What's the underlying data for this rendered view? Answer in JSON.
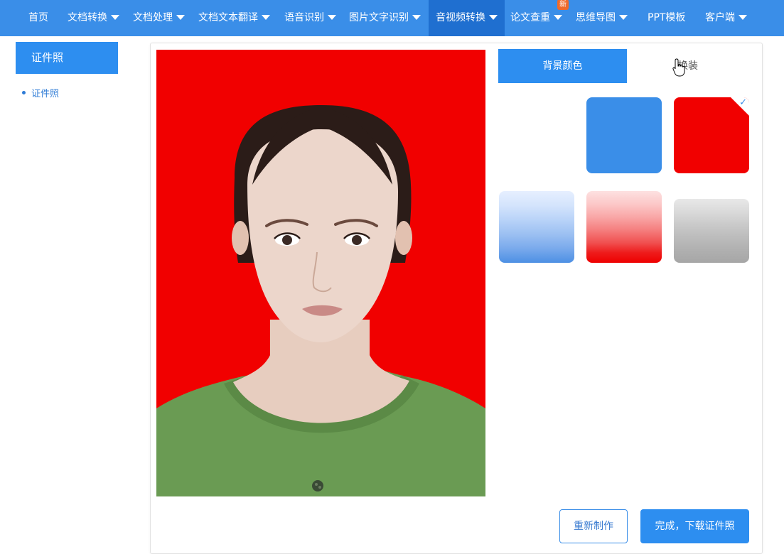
{
  "nav": {
    "items": [
      {
        "label": "首页",
        "dropdown": false,
        "active": false
      },
      {
        "label": "文档转换",
        "dropdown": true,
        "active": false
      },
      {
        "label": "文档处理",
        "dropdown": true,
        "active": false
      },
      {
        "label": "文档文本翻译",
        "dropdown": true,
        "active": false
      },
      {
        "label": "语音识别",
        "dropdown": true,
        "active": false
      },
      {
        "label": "图片文字识别",
        "dropdown": true,
        "active": false
      },
      {
        "label": "音视频转换",
        "dropdown": true,
        "active": true
      },
      {
        "label": "论文查重",
        "dropdown": true,
        "active": false,
        "badge": "新"
      },
      {
        "label": "思维导图",
        "dropdown": true,
        "active": false
      },
      {
        "label": "PPT模板",
        "dropdown": false,
        "active": false
      },
      {
        "label": "客户端",
        "dropdown": true,
        "active": false
      }
    ]
  },
  "sidebar": {
    "title": "证件照",
    "link": "证件照"
  },
  "tabs": {
    "background": "背景颜色",
    "outfit": "换装"
  },
  "swatches": [
    {
      "name": "blue",
      "color": "#3a8ee8",
      "selected": false
    },
    {
      "name": "red",
      "color": "#f10000",
      "selected": true
    },
    {
      "name": "gradient-blue",
      "color": "#4d90e4",
      "selected": false
    },
    {
      "name": "gradient-red",
      "color": "#ee0000",
      "selected": false
    },
    {
      "name": "gradient-gray",
      "color": "#a6a6a6",
      "selected": false
    }
  ],
  "buttons": {
    "redo": "重新制作",
    "done": "完成，下载证件照"
  },
  "colors": {
    "accent": "#2d8ef0",
    "nav_bg": "#3a8ee8",
    "photo_bg": "#f10000"
  }
}
